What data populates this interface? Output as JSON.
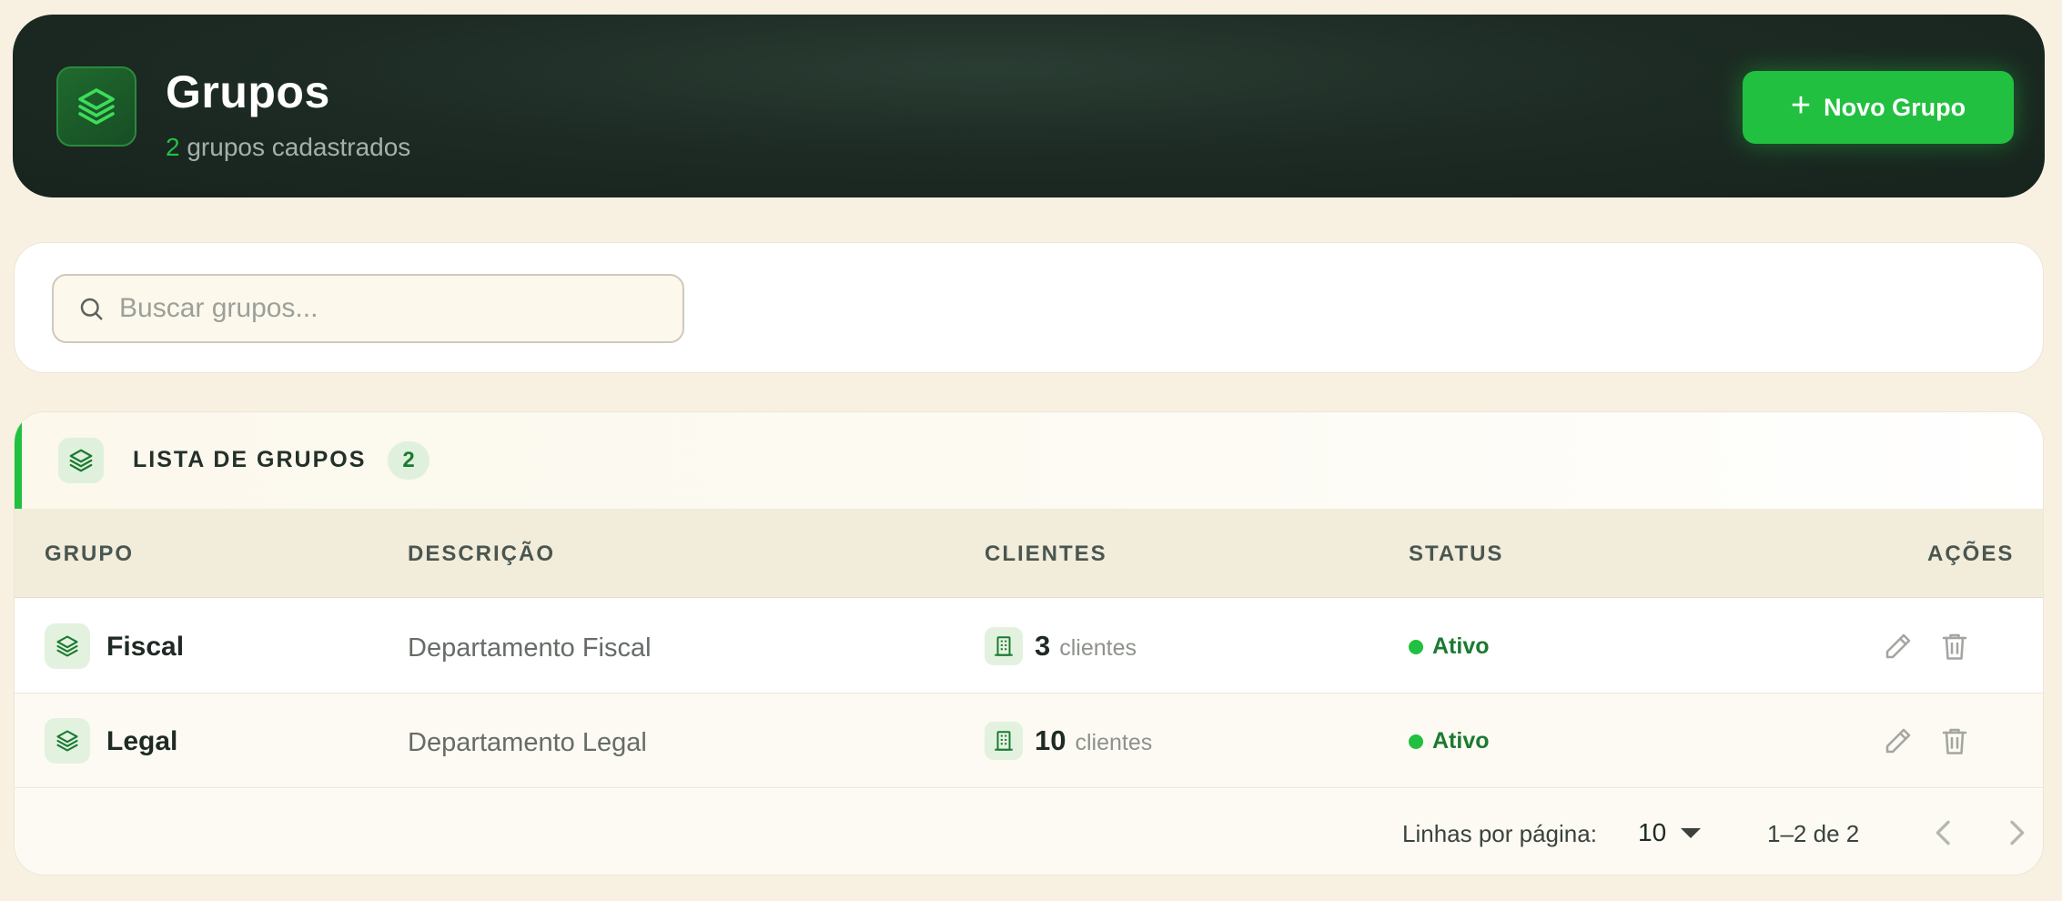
{
  "header": {
    "title": "Grupos",
    "count": "2",
    "subtitle_suffix": "grupos cadastrados",
    "new_button_label": "Novo Grupo",
    "icon": "layers-icon"
  },
  "search": {
    "placeholder": "Buscar grupos...",
    "value": ""
  },
  "list": {
    "title": "LISTA DE GRUPOS",
    "badge": "2",
    "columns": [
      "GRUPO",
      "DESCRIÇÃO",
      "CLIENTES",
      "STATUS",
      "AÇÕES"
    ],
    "rows": [
      {
        "name": "Fiscal",
        "description": "Departamento Fiscal",
        "clients": "3",
        "clients_label": "clientes",
        "status": "Ativo"
      },
      {
        "name": "Legal",
        "description": "Departamento Legal",
        "clients": "10",
        "clients_label": "clientes",
        "status": "Ativo"
      }
    ]
  },
  "pagination": {
    "rows_label": "Linhas por página:",
    "rows_value": "10",
    "range": "1–2 de 2"
  },
  "colors": {
    "accent": "#22c040",
    "header_bg": "#1d2b24",
    "page_bg": "#f8f1e2",
    "status_active": "#1b7a32"
  }
}
